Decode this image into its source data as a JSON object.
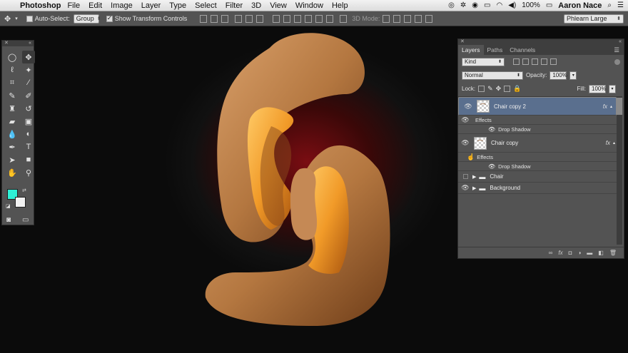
{
  "menubar": {
    "apple": "",
    "app_name": "Photoshop",
    "items": [
      "File",
      "Edit",
      "Image",
      "Layer",
      "Type",
      "Select",
      "Filter",
      "3D",
      "View",
      "Window",
      "Help"
    ],
    "battery": "100%",
    "user": "Aaron Nace"
  },
  "options_bar": {
    "auto_select_label": "Auto-Select:",
    "auto_select_value": "Group",
    "show_transform_label": "Show Transform Controls",
    "mode_3d_label": "3D Mode:",
    "workspace_value": "Phlearn Large"
  },
  "toolbox": {
    "foreground_color": "#2ef0d6",
    "background_color": "#f2f2f2"
  },
  "layers_panel": {
    "tabs": [
      "Layers",
      "Paths",
      "Channels"
    ],
    "filter_kind": "Kind",
    "blend_mode": "Normal",
    "opacity_label": "Opacity:",
    "opacity_value": "100%",
    "lock_label": "Lock:",
    "fill_label": "Fill:",
    "fill_value": "100%",
    "layers": [
      {
        "name": "Chair copy 2",
        "fx": "fx",
        "effects_label": "Effects",
        "effect": "Drop Shadow"
      },
      {
        "name": "Chair copy",
        "fx": "fx",
        "effects_label": "Effects",
        "effect": "Drop Shadow"
      },
      {
        "name": "Chair"
      },
      {
        "name": "Background"
      }
    ],
    "footer_fx": "fx"
  }
}
